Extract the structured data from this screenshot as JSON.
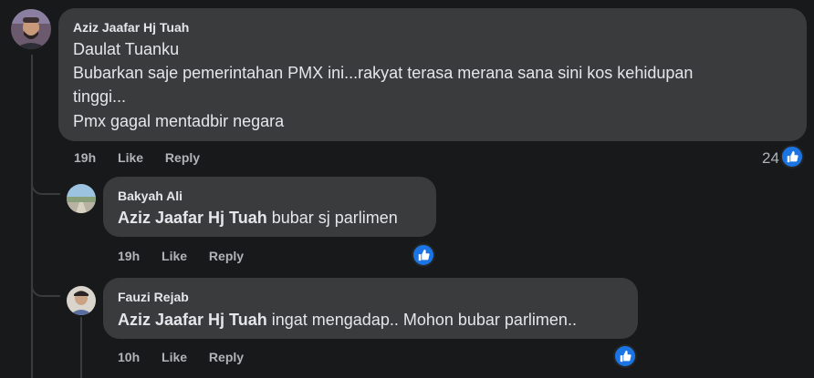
{
  "comments": [
    {
      "author": "Aziz Jaafar Hj Tuah",
      "lines": [
        "Daulat Tuanku",
        "Bubarkan saje pemerintahan PMX ini...rakyat terasa merana sana sini kos kehidupan",
        "tinggi...",
        "Pmx gagal mentadbir negara"
      ],
      "time": "19h",
      "like_label": "Like",
      "reply_label": "Reply",
      "reaction_count": "24"
    },
    {
      "author": "Bakyah Ali",
      "mention": "Aziz Jaafar Hj Tuah",
      "text": "bubar sj parlimen",
      "time": "19h",
      "like_label": "Like",
      "reply_label": "Reply"
    },
    {
      "author": "Fauzi Rejab",
      "mention": "Aziz Jaafar Hj Tuah",
      "text": "ingat mengadap.. Mohon bubar parlimen..",
      "time": "10h",
      "like_label": "Like",
      "reply_label": "Reply"
    }
  ],
  "colors": {
    "background": "#18191a",
    "bubble": "#3a3b3c",
    "text": "#e4e6eb",
    "secondary_text": "#b0b3b8",
    "like_blue": "#1b74e4"
  },
  "icons": {
    "reaction": "thumbs-up-icon"
  }
}
